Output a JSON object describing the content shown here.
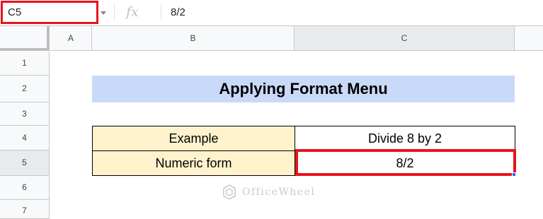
{
  "formula_bar": {
    "name_box": "C5",
    "fx_icon": "function-icon",
    "formula": "8/2"
  },
  "columns": [
    "A",
    "B",
    "C"
  ],
  "rows": [
    "1",
    "2",
    "3",
    "4",
    "5",
    "6",
    "7"
  ],
  "sheet": {
    "title": "Applying Format Menu",
    "table": [
      {
        "label": "Example",
        "value": "Divide 8 by 2"
      },
      {
        "label": "Numeric form",
        "value": "8/2"
      }
    ]
  },
  "watermark": {
    "text": "OfficeWheel",
    "icon": "officewheel-logo-icon"
  },
  "colors": {
    "title_fill": "#c9daf8",
    "label_fill": "#fff2cc",
    "highlight": "#e8141b",
    "selection_handle": "#1a73e8"
  },
  "selected_cell": "C5"
}
